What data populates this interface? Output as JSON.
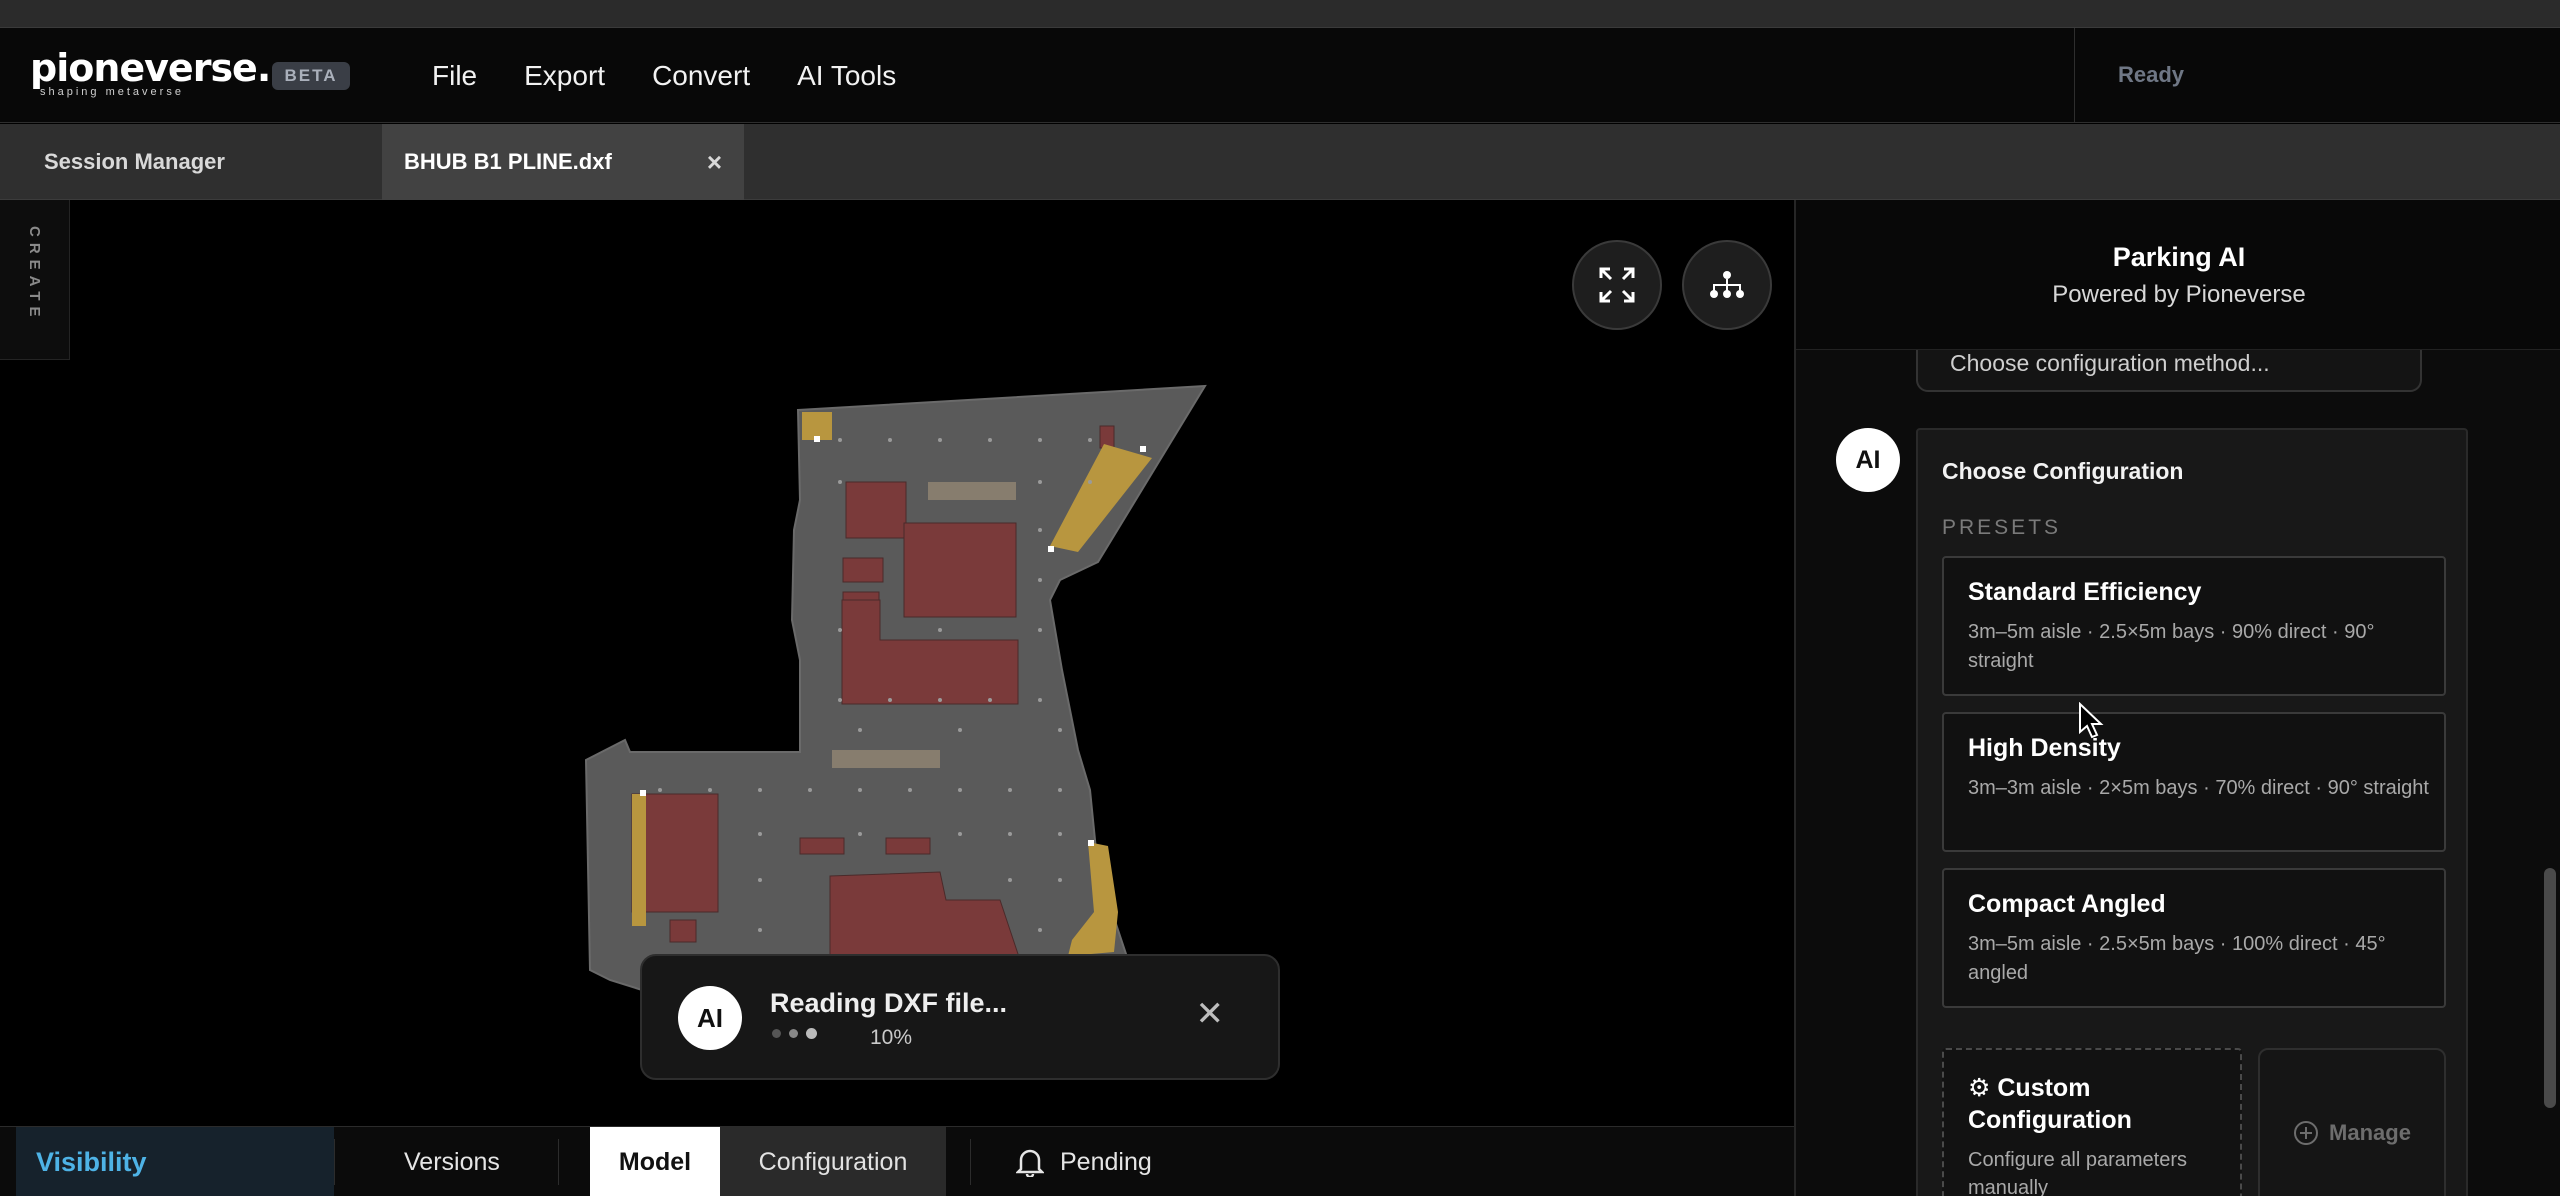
{
  "app": {
    "logo": "pioneverse.",
    "logo_tagline": "shaping metaverse",
    "beta_badge": "BETA",
    "status": "Ready"
  },
  "menu": {
    "items": [
      {
        "label": "File"
      },
      {
        "label": "Export"
      },
      {
        "label": "Convert"
      },
      {
        "label": "AI Tools"
      }
    ]
  },
  "tabs": {
    "session": "Session Manager",
    "file": "BHUB B1 PLINE.dxf",
    "close_glyph": "×"
  },
  "canvas": {
    "create_label": "CREATE",
    "fullscreen_icon": "expand-icon",
    "hierarchy_icon": "hierarchy-icon"
  },
  "toast": {
    "avatar": "AI",
    "title": "Reading DXF file...",
    "progress_text": "10%",
    "progress": 0.1,
    "close_glyph": "✕"
  },
  "bottombar": {
    "visibility": "Visibility",
    "versions": "Versions",
    "model": "Model",
    "configuration": "Configuration",
    "pending": "Pending"
  },
  "panel": {
    "title": "Parking AI",
    "subtitle": "Powered by Pioneverse",
    "previous_message": "Choose configuration method...",
    "ai_avatar": "AI",
    "config_title": "Choose Configuration",
    "presets_label": "PRESETS",
    "presets": [
      {
        "name": "Standard Efficiency",
        "desc": "3m–5m aisle · 2.5×5m bays · 90% direct · 90° straight"
      },
      {
        "name": "High Density",
        "desc": "3m–3m aisle · 2×5m bays · 70% direct · 90° straight"
      },
      {
        "name": "Compact Angled",
        "desc": "3m–5m aisle · 2.5×5m bays · 100% direct · 45° angled"
      }
    ],
    "custom": {
      "icon": "⚙",
      "name": "Custom Configuration",
      "desc": "Configure all parameters manually"
    },
    "manage": "Manage"
  },
  "colors": {
    "accent_blue": "#4eb3e6",
    "floor_gray": "#5a5a5a",
    "room_red": "#7a3a3a",
    "ramp_gold": "#b8963f"
  }
}
